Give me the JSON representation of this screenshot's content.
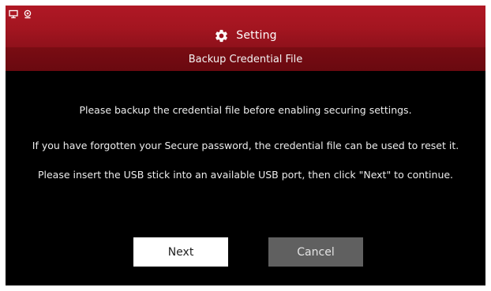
{
  "header": {
    "status_icons": [
      "monitor-icon",
      "webcam-icon"
    ],
    "title_icon": "gear-icon",
    "title": "Setting"
  },
  "subheader": {
    "title": "Backup Credential File"
  },
  "messages": [
    "Please backup the credential file before enabling securing settings.",
    "If you have forgotten your Secure password, the credential file can be used to reset it.",
    "Please insert the USB stick into an available USB port, then click \"Next\" to continue."
  ],
  "buttons": {
    "next_label": "Next",
    "cancel_label": "Cancel"
  },
  "colors": {
    "header": "#a31520",
    "subheader": "#6e0a11",
    "background": "#000000",
    "next_button": "#ffffff",
    "cancel_button": "#606060"
  }
}
